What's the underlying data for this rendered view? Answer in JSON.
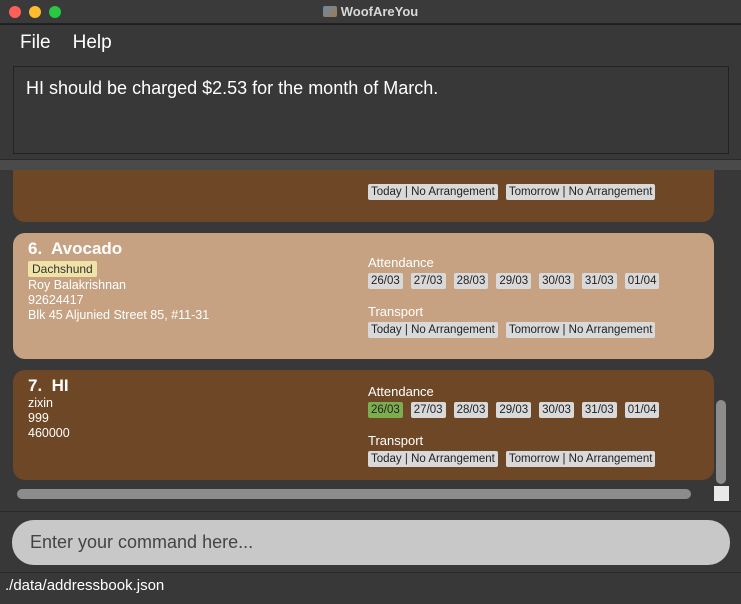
{
  "window": {
    "title": "WoofAreYou"
  },
  "menu": {
    "file": "File",
    "help": "Help"
  },
  "result": "HI should be charged $2.53 for the month of March.",
  "labels": {
    "attendance": "Attendance",
    "transport": "Transport"
  },
  "cards": [
    {
      "transport": [
        "Today | No Arrangement",
        "Tomorrow | No Arrangement"
      ]
    },
    {
      "index": "6.",
      "name": "Avocado",
      "tag": "Dachshund",
      "owner": "Roy Balakrishnan",
      "phone": "92624417",
      "address": "Blk 45 Aljunied Street 85, #11-31",
      "attendance": [
        "26/03",
        "27/03",
        "28/03",
        "29/03",
        "30/03",
        "31/03",
        "01/04"
      ],
      "transport": [
        "Today | No Arrangement",
        "Tomorrow | No Arrangement"
      ]
    },
    {
      "index": "7.",
      "name": "HI",
      "owner": "zixin",
      "phone": "999",
      "address": "460000",
      "attendance": [
        "26/03",
        "27/03",
        "28/03",
        "29/03",
        "30/03",
        "31/03",
        "01/04"
      ],
      "transport": [
        "Today | No Arrangement",
        "Tomorrow | No Arrangement"
      ]
    }
  ],
  "command": {
    "placeholder": "Enter your command here..."
  },
  "status": "./data/addressbook.json",
  "colors": {
    "card_dark": "#6e4726",
    "card_light": "#c6a283",
    "present": "#7cad4f",
    "tag": "#f0e3a7"
  }
}
